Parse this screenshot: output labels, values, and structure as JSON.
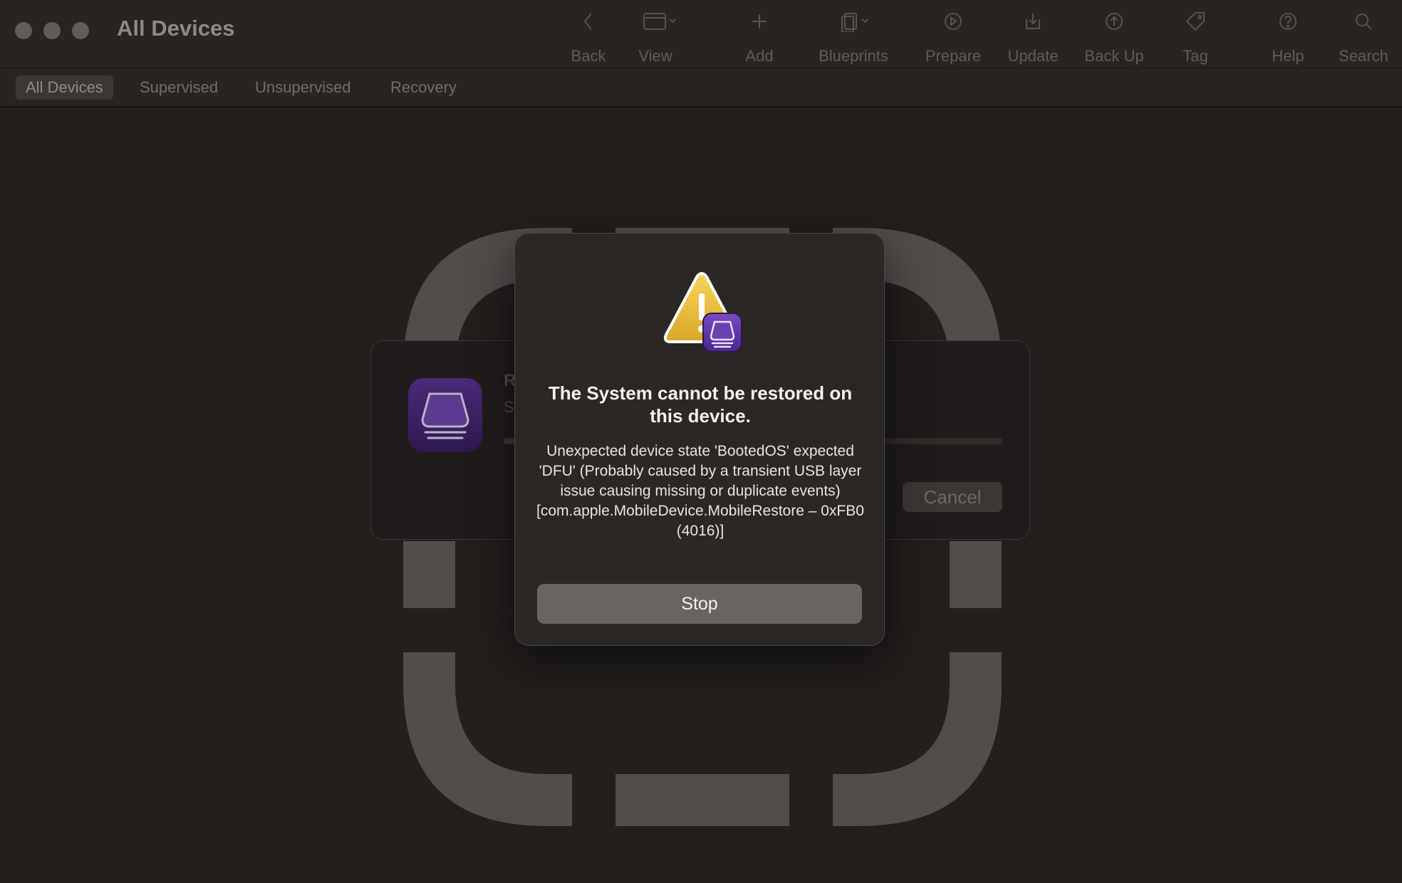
{
  "window": {
    "title": "All Devices"
  },
  "toolbar": {
    "items": [
      {
        "label": "Back",
        "icon": "chevron-left-icon"
      },
      {
        "label": "View",
        "icon": "window-icon"
      },
      {
        "label": "Add",
        "icon": "plus-icon"
      },
      {
        "label": "Blueprints",
        "icon": "blueprints-icon"
      },
      {
        "label": "Prepare",
        "icon": "prepare-icon"
      },
      {
        "label": "Update",
        "icon": "download-icon"
      },
      {
        "label": "Back Up",
        "icon": "upload-icon"
      },
      {
        "label": "Tag",
        "icon": "tag-icon"
      },
      {
        "label": "Help",
        "icon": "help-icon"
      },
      {
        "label": "Search",
        "icon": "search-icon"
      }
    ]
  },
  "scopes": [
    {
      "label": "All Devices",
      "active": true
    },
    {
      "label": "Supervised",
      "active": false
    },
    {
      "label": "Unsupervised",
      "active": false
    },
    {
      "label": "Recovery",
      "active": false
    }
  ],
  "progress_card": {
    "title_fragment": "R",
    "subtitle_fragment": "S",
    "cancel_label": "Cancel"
  },
  "alert": {
    "title": "The System cannot be restored on this device.",
    "message": "Unexpected device state 'BootedOS' expected 'DFU' (Probably caused by a transient USB layer issue causing missing or duplicate events) [com.apple.MobileDevice.MobileRestore – 0xFB0 (4016)]",
    "stop_label": "Stop"
  },
  "colors": {
    "background": "#221f1d",
    "accent_purple": "#5a34a0",
    "warning_yellow": "#f2c232"
  }
}
